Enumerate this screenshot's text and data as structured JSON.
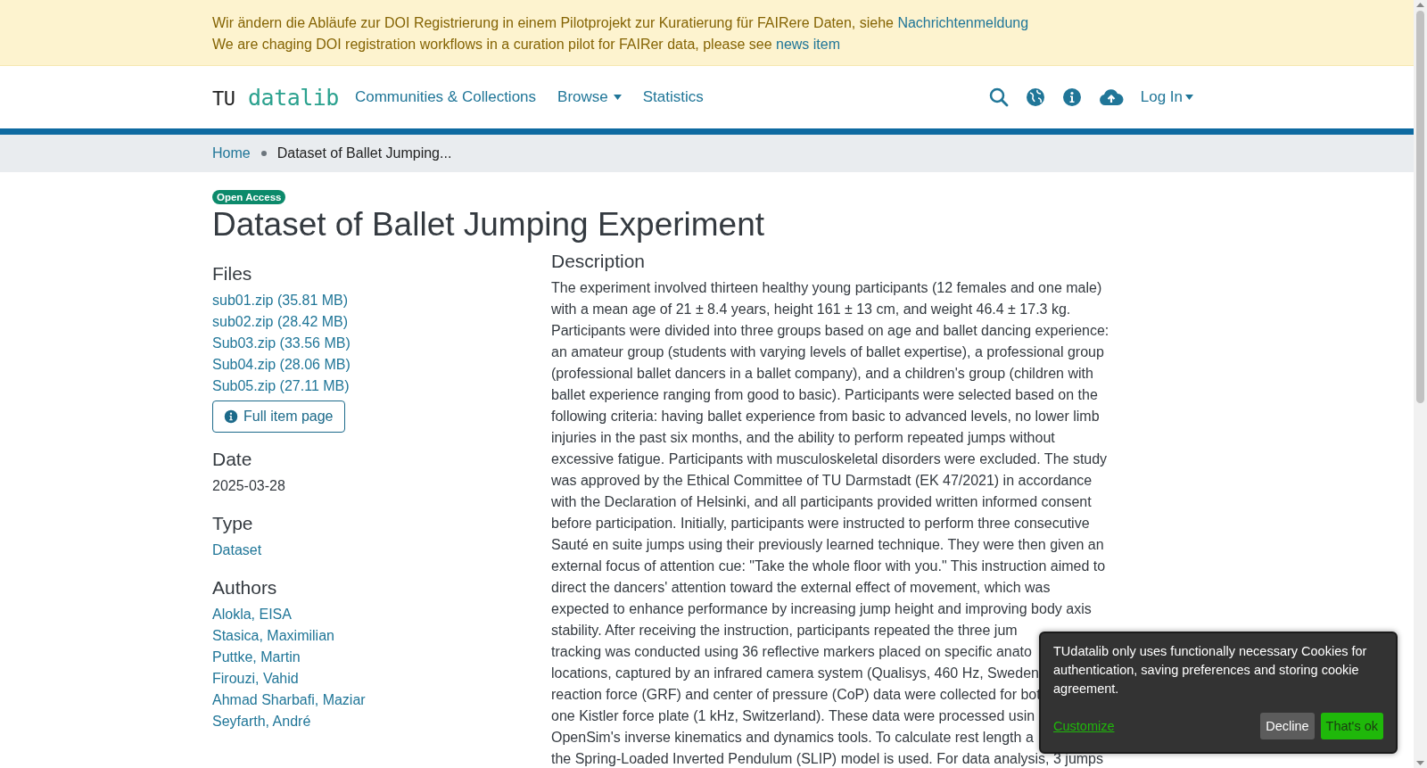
{
  "notice": {
    "lines": [
      {
        "text": "Wir ändern die Abläufe zur DOI Registrierung in einem Pilotprojekt zur Kuratierung für FAIRere Daten, siehe",
        "link": "Nachrichtenmeldung"
      },
      {
        "text": "We are chaging DOI registration workflows in a curation pilot for FAIRer data, please see",
        "link": "news item"
      }
    ]
  },
  "header": {
    "logo": {
      "prefix": "TU",
      "name": "datalib"
    },
    "nav": [
      {
        "label": "Communities & Collections",
        "dropdown": false
      },
      {
        "label": "Browse",
        "dropdown": true
      },
      {
        "label": "Statistics",
        "dropdown": false
      }
    ],
    "login": "Log In"
  },
  "breadcrumb": [
    {
      "label": "Home",
      "current": false
    },
    {
      "label": "Dataset of Ballet Jumping...",
      "current": true
    }
  ],
  "item": {
    "badge": "Open Access",
    "title": "Dataset of Ballet Jumping Experiment",
    "files": {
      "heading": "Files",
      "items": [
        "sub01.zip (35.81 MB)",
        "sub02.zip (28.42 MB)",
        "Sub03.zip (33.56 MB)",
        "Sub04.zip (28.06 MB)",
        "Sub05.zip (27.11 MB)"
      ],
      "button": "Full item page"
    },
    "date": {
      "heading": "Date",
      "value": "2025-03-28"
    },
    "type": {
      "heading": "Type",
      "value": "Dataset"
    },
    "authors": {
      "heading": "Authors",
      "items": [
        "Alokla, EISA",
        "Stasica, Maximilian",
        "Puttke, Martin",
        "Firouzi, Vahid",
        "Ahmad Sharbafi, Maziar",
        "Seyfarth, André"
      ]
    },
    "description": {
      "heading": "Description",
      "lines": [
        "The experiment involved thirteen healthy young participants (12 females and one male)",
        "with a mean age of 21 ± 8.4 years, height 161 ± 13 cm, and weight 46.4 ± 17.3 kg.",
        "Participants were divided into three groups based on age and ballet dancing experience:",
        "an amateur group (students with varying levels of ballet expertise), a professional group",
        "(professional ballet dancers in a ballet company), and a children's group (children with",
        "ballet experience ranging from good to basic). Participants were selected based on the",
        "following criteria: having ballet experience from basic to advanced levels, no lower limb",
        "injuries in the past six months, and the ability to perform repeated jumps without",
        "excessive fatigue. Participants with musculoskeletal disorders were excluded. The study",
        "was approved by the Ethical Committee of TU Darmstadt (EK 47/2021) in accordance",
        "with the Declaration of Helsinki, and all participants provided written informed consent",
        "before participation. Initially, participants were instructed to perform three consecutive",
        "Sauté en suite jumps using their previously learned technique. They were then given an",
        "external focus of attention cue: \"Take the whole floor with you.\" This instruction aimed to",
        "direct the dancers' attention toward the external effect of movement, which was",
        "expected to enhance performance by increasing jump height and improving body axis",
        "stability. After receiving the instruction, participants repeated the three jum",
        "tracking was conducted using 36 reflective markers placed on specific anato",
        "locations, captured by an infrared camera system (Qualisys, 460 Hz, Sweden",
        "reaction force (GRF) and center of pressure (CoP) data were collected for bot",
        "one Kistler force plate (1 kHz, Switzerland). These data were processed usin",
        "OpenSim's inverse kinematics and dynamics tools. To calculate rest length a",
        "the Spring-Loaded Inverted Pendulum (SLIP) model is used. For data analysis, 3 jumps"
      ]
    }
  },
  "cookie": {
    "message": "TUdatalib only uses functionally necessary Cookies for authentication, saving preferences and storing cookie agreement.",
    "customize": "Customize",
    "decline": "Decline",
    "accept": "That's ok"
  }
}
